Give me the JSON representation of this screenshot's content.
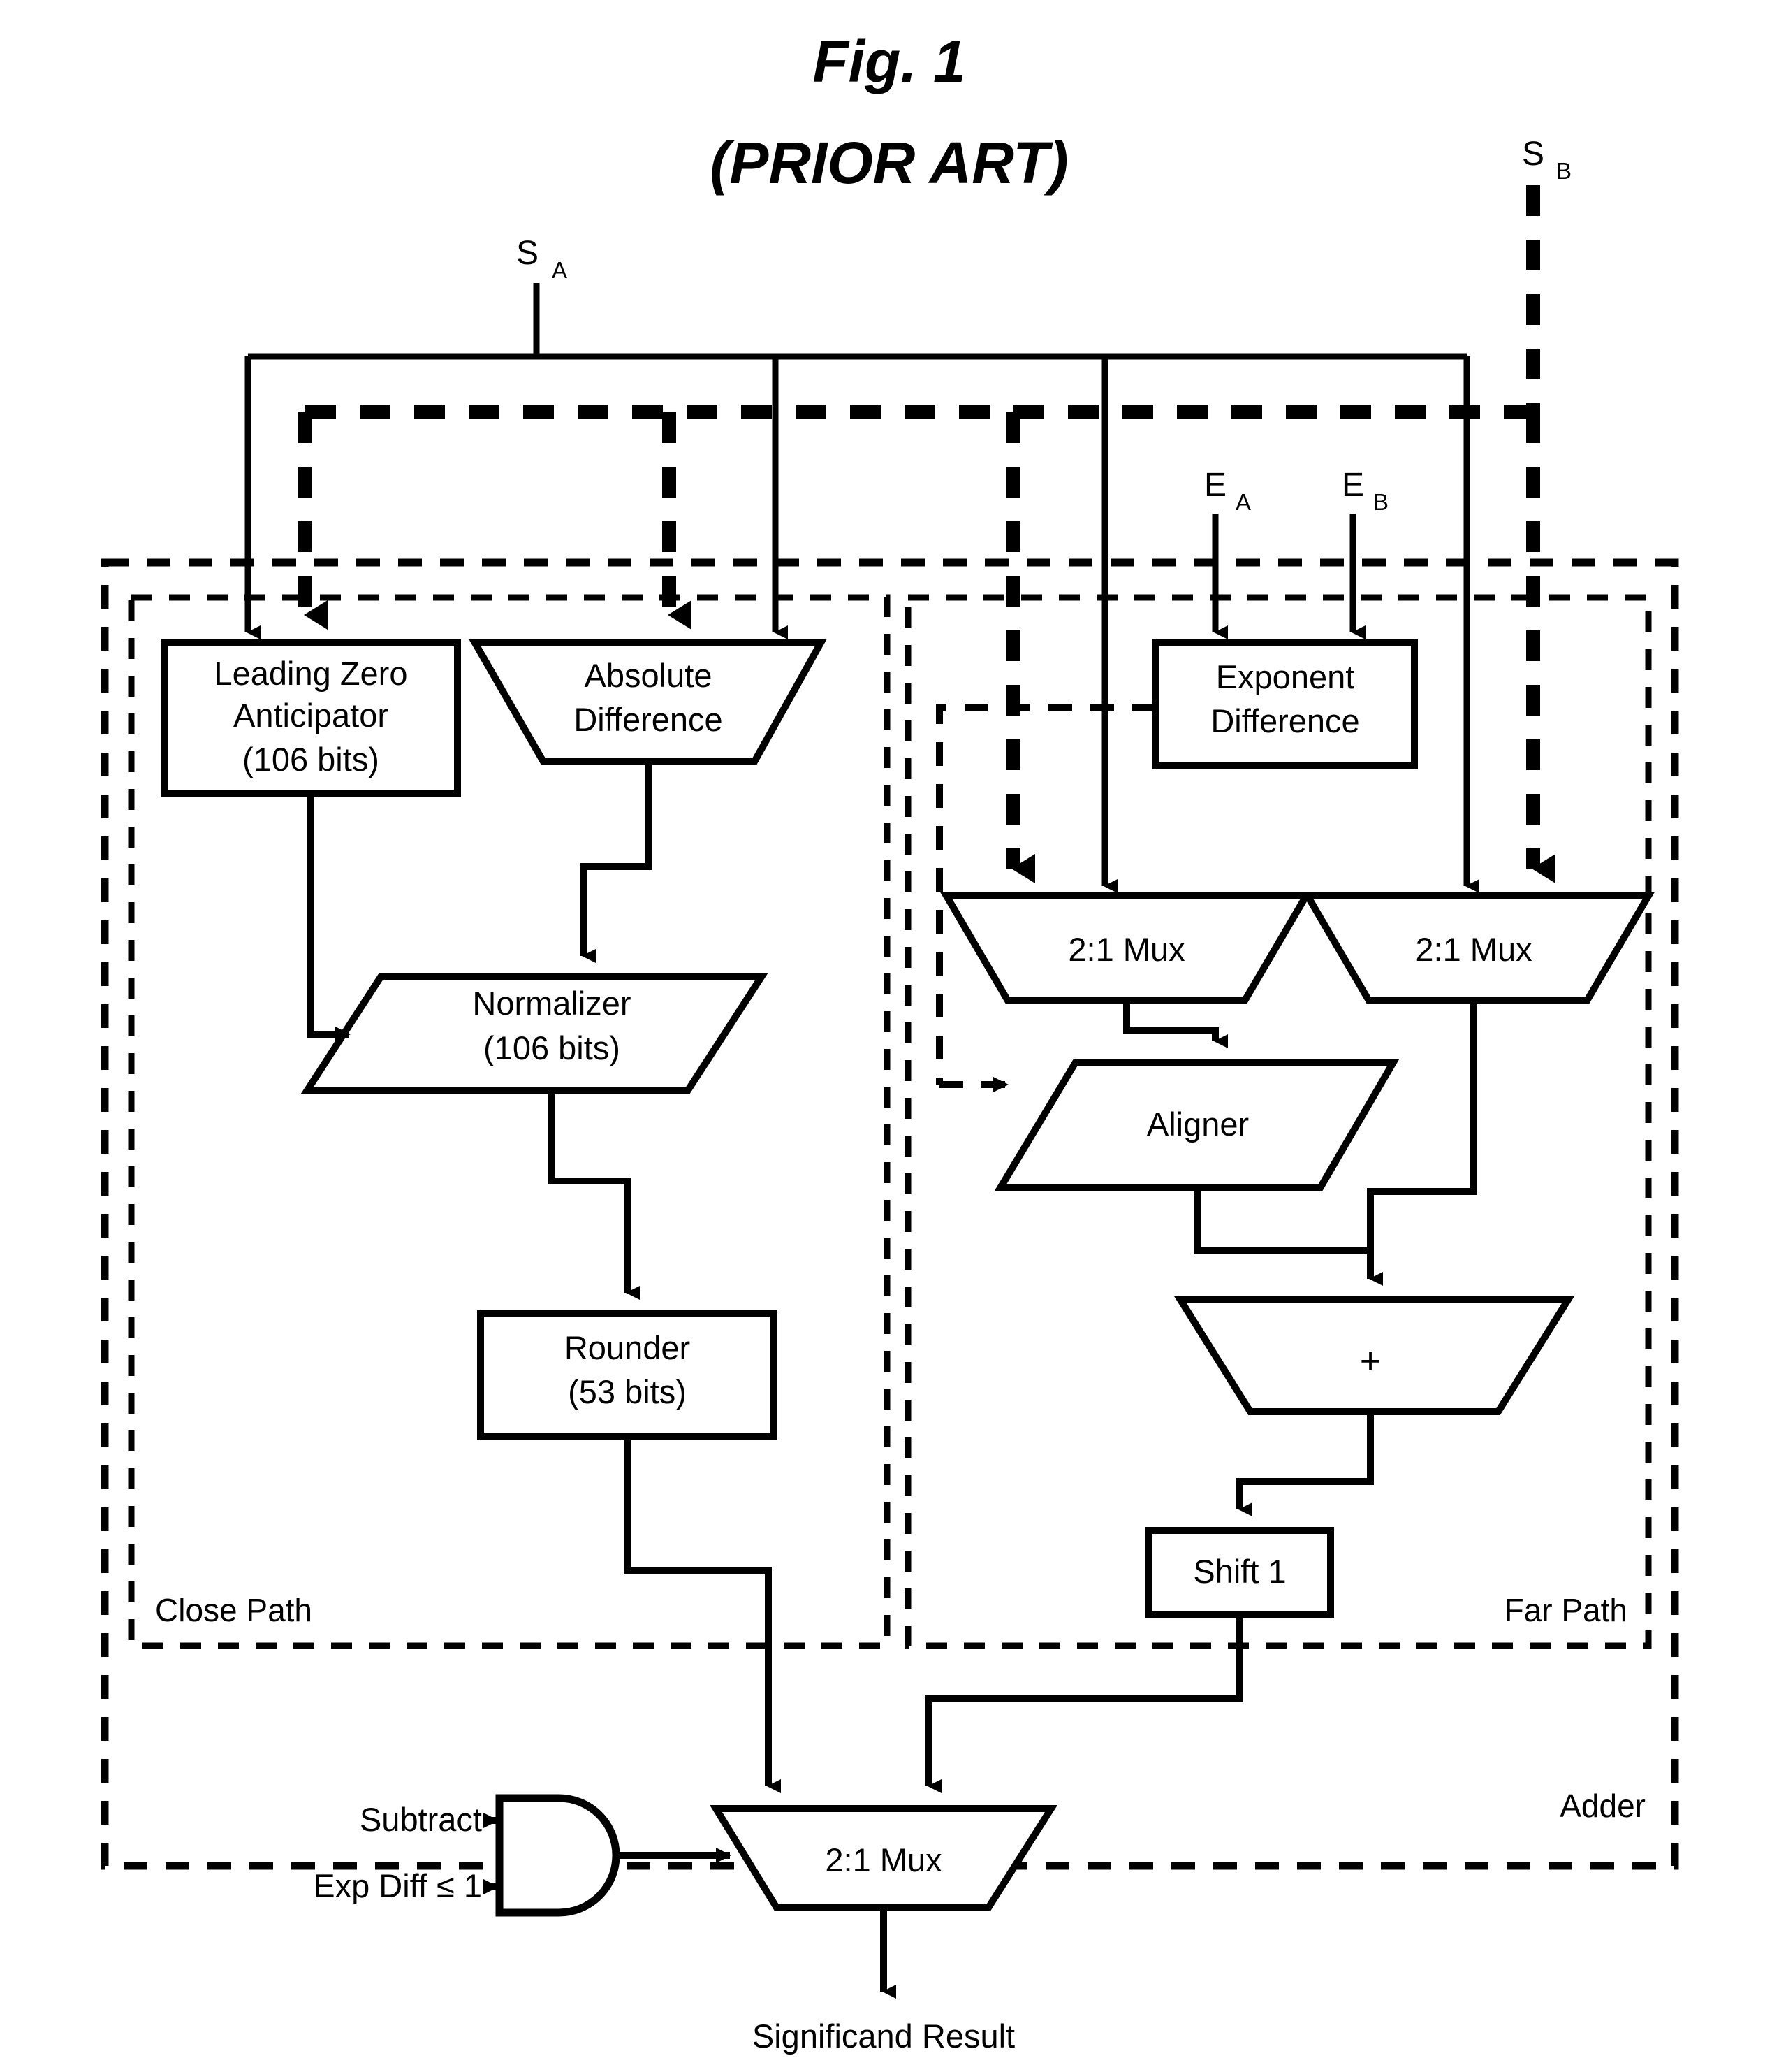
{
  "figure": {
    "title_line1": "Fig. 1",
    "title_line2": "(PRIOR ART)"
  },
  "inputs": {
    "sign_a": "S",
    "sign_a_sub": "A",
    "sign_b": "S",
    "sign_b_sub": "B",
    "exp_a": "E",
    "exp_a_sub": "A",
    "exp_b": "E",
    "exp_b_sub": "B"
  },
  "regions": {
    "close_path": "Close Path",
    "far_path": "Far Path",
    "adder": "Adder"
  },
  "blocks": {
    "lza_line1": "Leading Zero",
    "lza_line2": "Anticipator",
    "lza_line3": "(106 bits)",
    "absdiff_line1": "Absolute",
    "absdiff_line2": "Difference",
    "normalizer_line1": "Normalizer",
    "normalizer_line2": "(106 bits)",
    "rounder_line1": "Rounder",
    "rounder_line2": "(53 bits)",
    "expdiff_line1": "Exponent",
    "expdiff_line2": "Difference",
    "mux_left": "2:1 Mux",
    "mux_right": "2:1 Mux",
    "aligner": "Aligner",
    "adder_plus": "+",
    "shift1": "Shift 1",
    "final_mux": "2:1 Mux"
  },
  "control": {
    "subtract": "Subtract",
    "exp_diff_le_1": "Exp Diff ≤ 1"
  },
  "output": {
    "significand_result": "Significand Result"
  },
  "colors": {
    "stroke": "#000000",
    "background": "#ffffff"
  }
}
